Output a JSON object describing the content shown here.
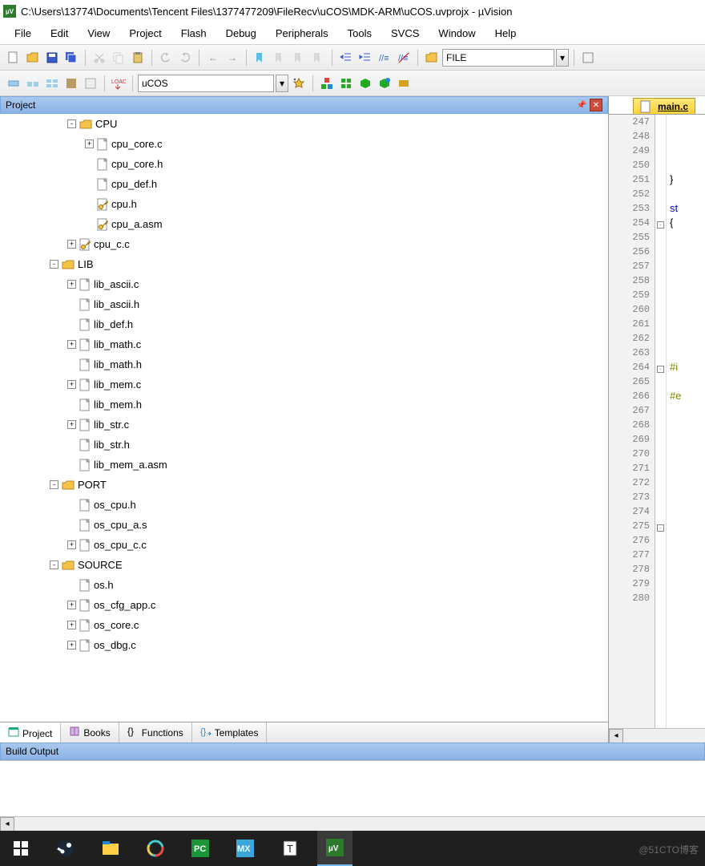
{
  "title": "C:\\Users\\13774\\Documents\\Tencent Files\\1377477209\\FileRecv\\uCOS\\MDK-ARM\\uCOS.uvprojx - µVision",
  "menu": [
    "File",
    "Edit",
    "View",
    "Project",
    "Flash",
    "Debug",
    "Peripherals",
    "Tools",
    "SVCS",
    "Window",
    "Help"
  ],
  "toolbar2_combo": "uCOS",
  "file_combo": "FILE",
  "project_panel_title": "Project",
  "tree": [
    {
      "depth": 2,
      "exp": "-",
      "kind": "folder",
      "label": "CPU"
    },
    {
      "depth": 3,
      "exp": "+",
      "kind": "file",
      "label": "cpu_core.c"
    },
    {
      "depth": 3,
      "exp": " ",
      "kind": "file",
      "label": "cpu_core.h"
    },
    {
      "depth": 3,
      "exp": " ",
      "kind": "file",
      "label": "cpu_def.h"
    },
    {
      "depth": 3,
      "exp": " ",
      "kind": "key",
      "label": "cpu.h"
    },
    {
      "depth": 3,
      "exp": " ",
      "kind": "key",
      "label": "cpu_a.asm"
    },
    {
      "depth": 2,
      "exp": "+",
      "kind": "key",
      "label": "cpu_c.c"
    },
    {
      "depth": 1,
      "exp": "-",
      "kind": "folder",
      "label": "LIB"
    },
    {
      "depth": 2,
      "exp": "+",
      "kind": "file",
      "label": "lib_ascii.c"
    },
    {
      "depth": 2,
      "exp": " ",
      "kind": "file",
      "label": "lib_ascii.h"
    },
    {
      "depth": 2,
      "exp": " ",
      "kind": "file",
      "label": "lib_def.h"
    },
    {
      "depth": 2,
      "exp": "+",
      "kind": "file",
      "label": "lib_math.c"
    },
    {
      "depth": 2,
      "exp": " ",
      "kind": "file",
      "label": "lib_math.h"
    },
    {
      "depth": 2,
      "exp": "+",
      "kind": "file",
      "label": "lib_mem.c"
    },
    {
      "depth": 2,
      "exp": " ",
      "kind": "file",
      "label": "lib_mem.h"
    },
    {
      "depth": 2,
      "exp": "+",
      "kind": "file",
      "label": "lib_str.c"
    },
    {
      "depth": 2,
      "exp": " ",
      "kind": "file",
      "label": "lib_str.h"
    },
    {
      "depth": 2,
      "exp": " ",
      "kind": "file",
      "label": "lib_mem_a.asm"
    },
    {
      "depth": 1,
      "exp": "-",
      "kind": "folder",
      "label": "PORT"
    },
    {
      "depth": 2,
      "exp": " ",
      "kind": "file",
      "label": "os_cpu.h"
    },
    {
      "depth": 2,
      "exp": " ",
      "kind": "file",
      "label": "os_cpu_a.s"
    },
    {
      "depth": 2,
      "exp": "+",
      "kind": "file",
      "label": "os_cpu_c.c"
    },
    {
      "depth": 1,
      "exp": "-",
      "kind": "folder",
      "label": "SOURCE"
    },
    {
      "depth": 2,
      "exp": " ",
      "kind": "file",
      "label": "os.h"
    },
    {
      "depth": 2,
      "exp": "+",
      "kind": "file",
      "label": "os_cfg_app.c"
    },
    {
      "depth": 2,
      "exp": "+",
      "kind": "file",
      "label": "os_core.c"
    },
    {
      "depth": 2,
      "exp": "+",
      "kind": "file",
      "label": "os_dbg.c"
    }
  ],
  "bottom_tabs": [
    "Project",
    "Books",
    "Functions",
    "Templates"
  ],
  "editor_tab": "main.c",
  "line_start": 247,
  "line_end": 280,
  "code_lines": {
    "251": {
      "text": "}",
      "class": ""
    },
    "253": {
      "text": "st",
      "class": "kw"
    },
    "254": {
      "text": "{",
      "class": "",
      "fold": "-"
    },
    "264": {
      "text": "#i",
      "class": "pp",
      "fold": "-"
    },
    "266": {
      "text": "#e",
      "class": "pp"
    },
    "275": {
      "text": "",
      "fold": "-"
    }
  },
  "build_title": "Build Output",
  "watermark": "@51CTO博客"
}
